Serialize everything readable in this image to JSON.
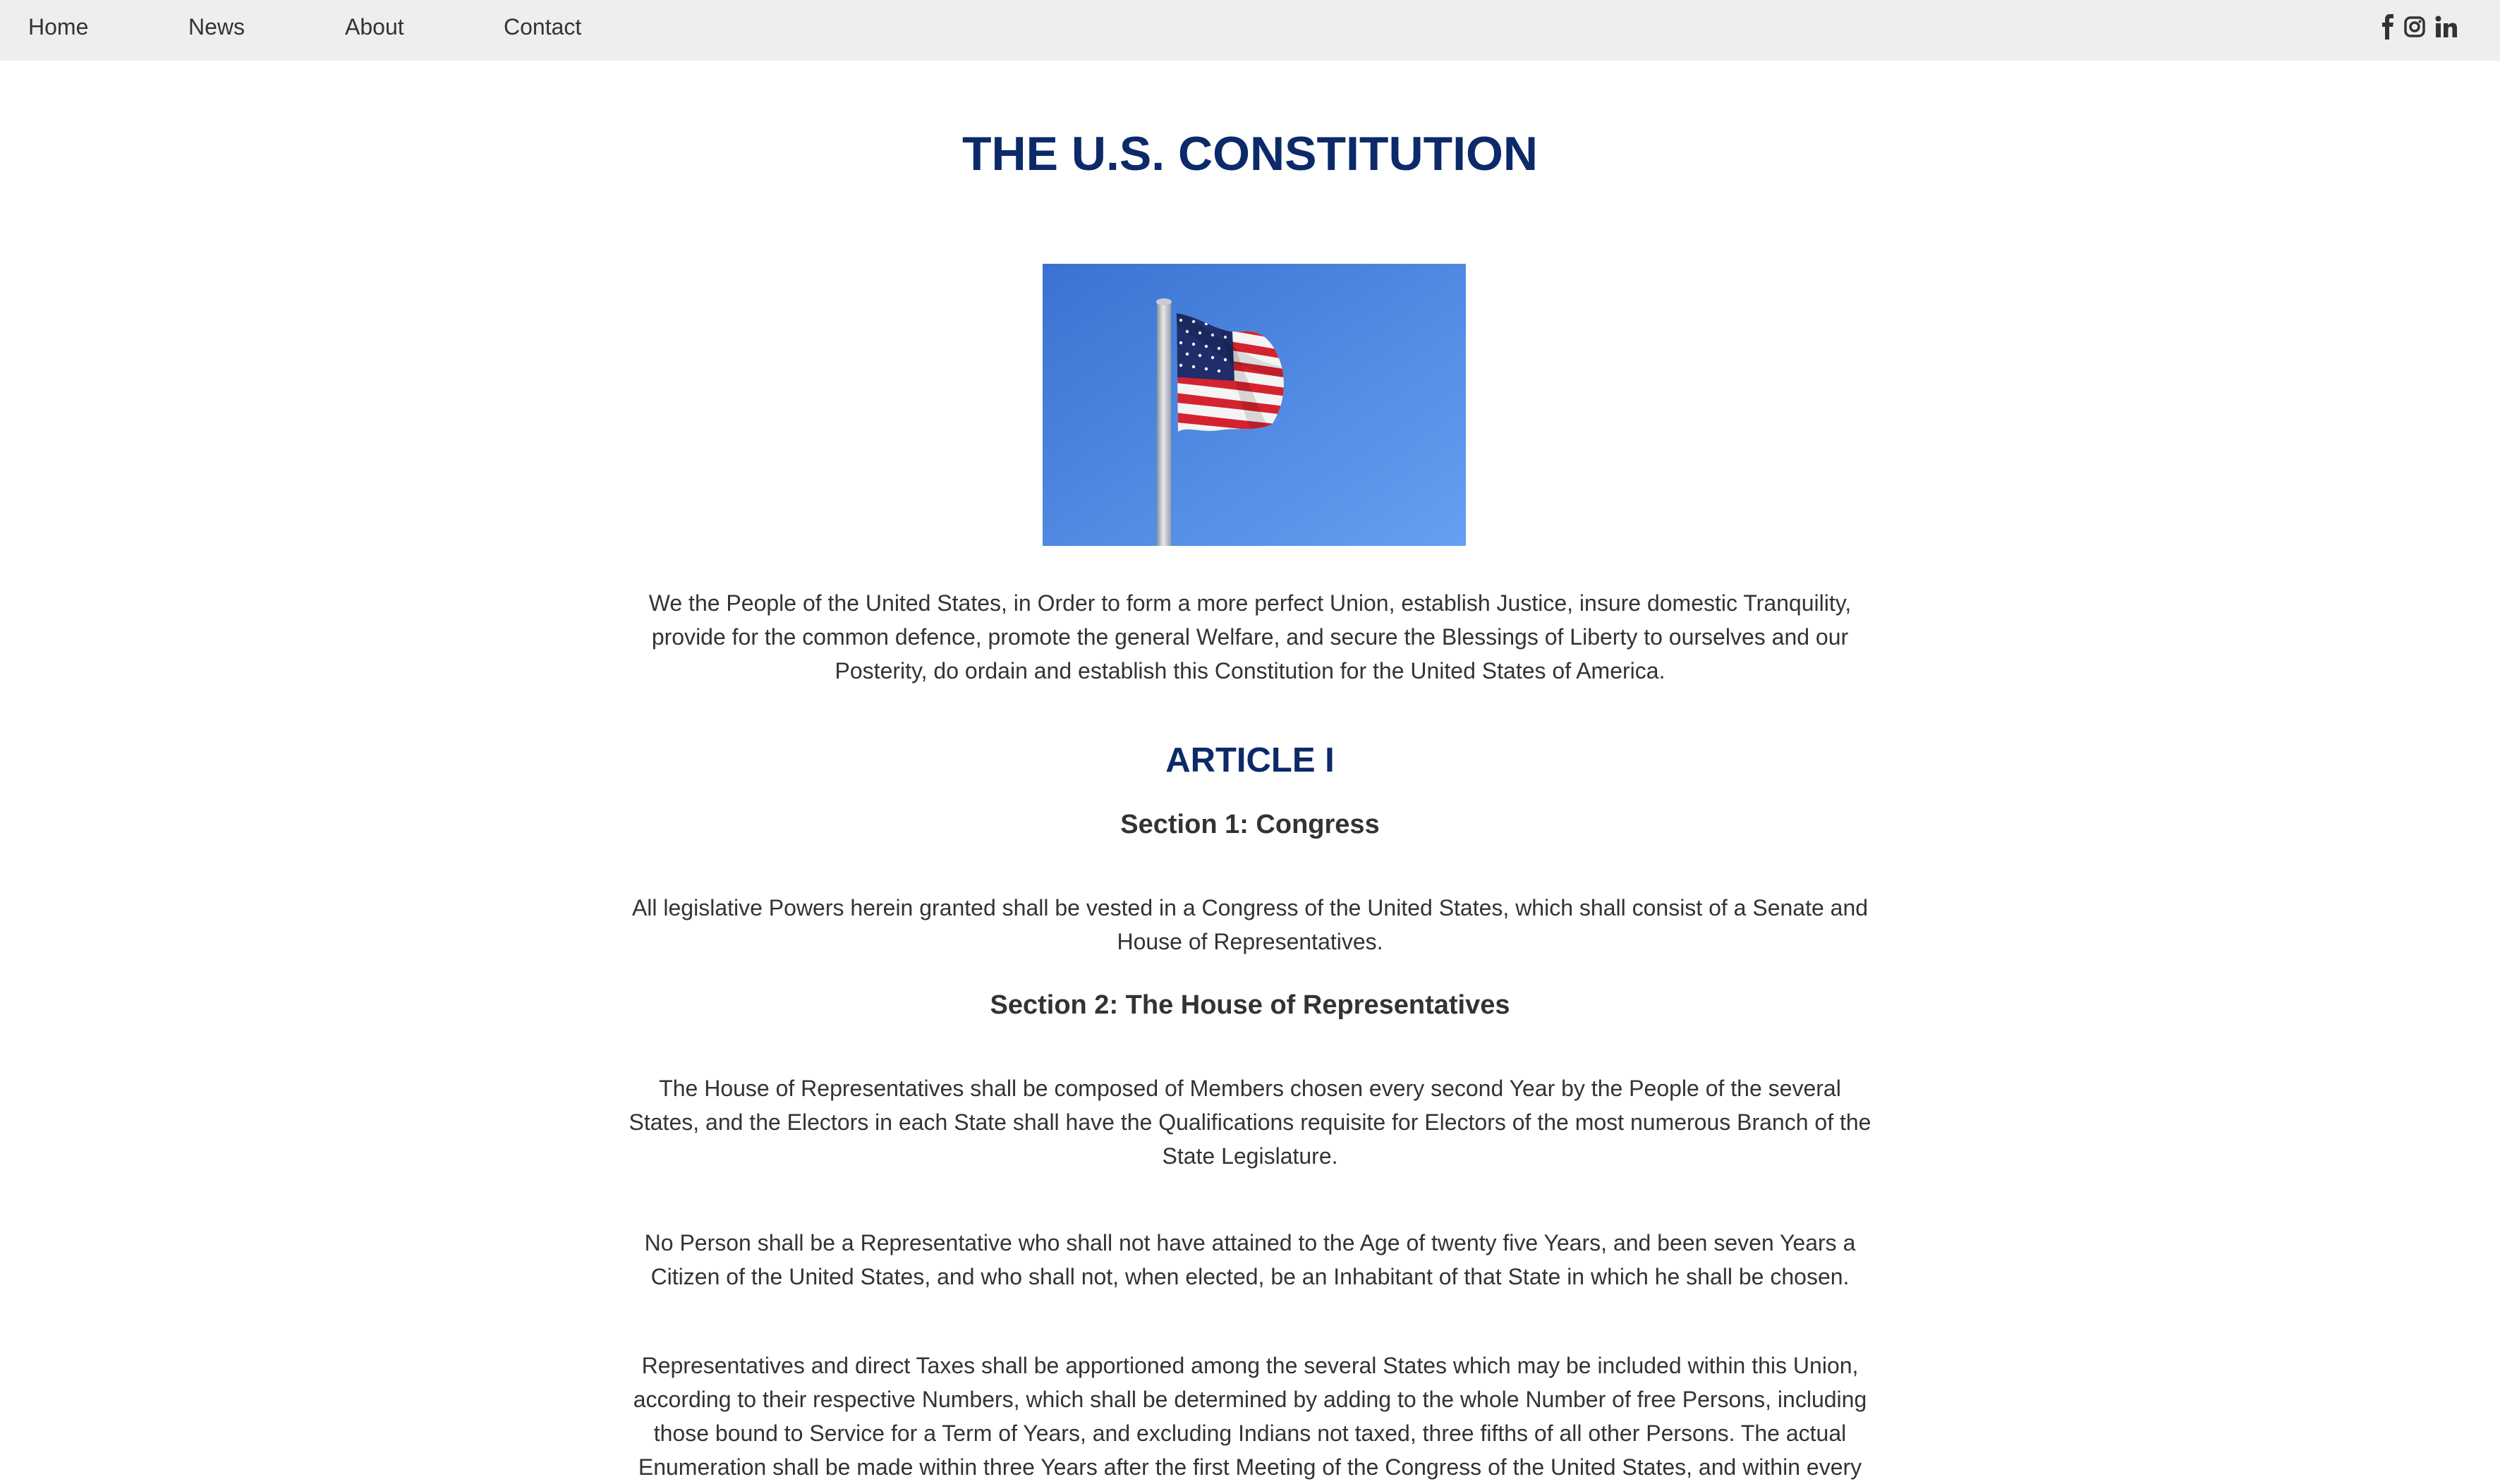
{
  "nav": {
    "links": [
      "Home",
      "News",
      "About",
      "Contact"
    ],
    "social_icons": [
      "facebook-icon",
      "instagram-icon",
      "linkedin-icon"
    ]
  },
  "page": {
    "title": "THE U.S. CONSTITUTION",
    "hero_image": "american-flag-on-pole",
    "preamble": "We the People of the United States, in Order to form a more perfect Union, establish Justice, insure domestic Tranquility, provide for the common defence, promote the general Welfare, and secure the Blessings of Liberty to ourselves and our Posterity, do ordain and establish this Constitution for the United States of America.",
    "article_title": "ARTICLE I",
    "sections": [
      {
        "heading": "Section 1: Congress",
        "paragraphs": [
          "All legislative Powers herein granted shall be vested in a Congress of the United States, which shall consist of a Senate and House of Representatives."
        ]
      },
      {
        "heading": "Section 2: The House of Representatives",
        "paragraphs": [
          "The House of Representatives shall be composed of Members chosen every second Year by the People of the several States, and the Electors in each State shall have the Qualifications requisite for Electors of the most numerous Branch of the State Legislature.",
          "No Person shall be a Representative who shall not have attained to the Age of twenty five Years, and been seven Years a Citizen of the United States, and who shall not, when elected, be an Inhabitant of that State in which he shall be chosen.",
          "Representatives and direct Taxes shall be apportioned among the several States which may be included within this Union, according to their respective Numbers, which shall be determined by adding to the whole Number of free Persons, including those bound to Service for a Term of Years, and excluding Indians not taxed, three fifths of all other Persons. The actual Enumeration shall be made within three Years after the first Meeting of the Congress of the United States, and within every"
        ]
      }
    ]
  },
  "colors": {
    "heading_blue": "#0c2a69",
    "nav_bg": "#eeeeee",
    "body_text": "#333333",
    "sky_blue": "#4f86e2"
  }
}
